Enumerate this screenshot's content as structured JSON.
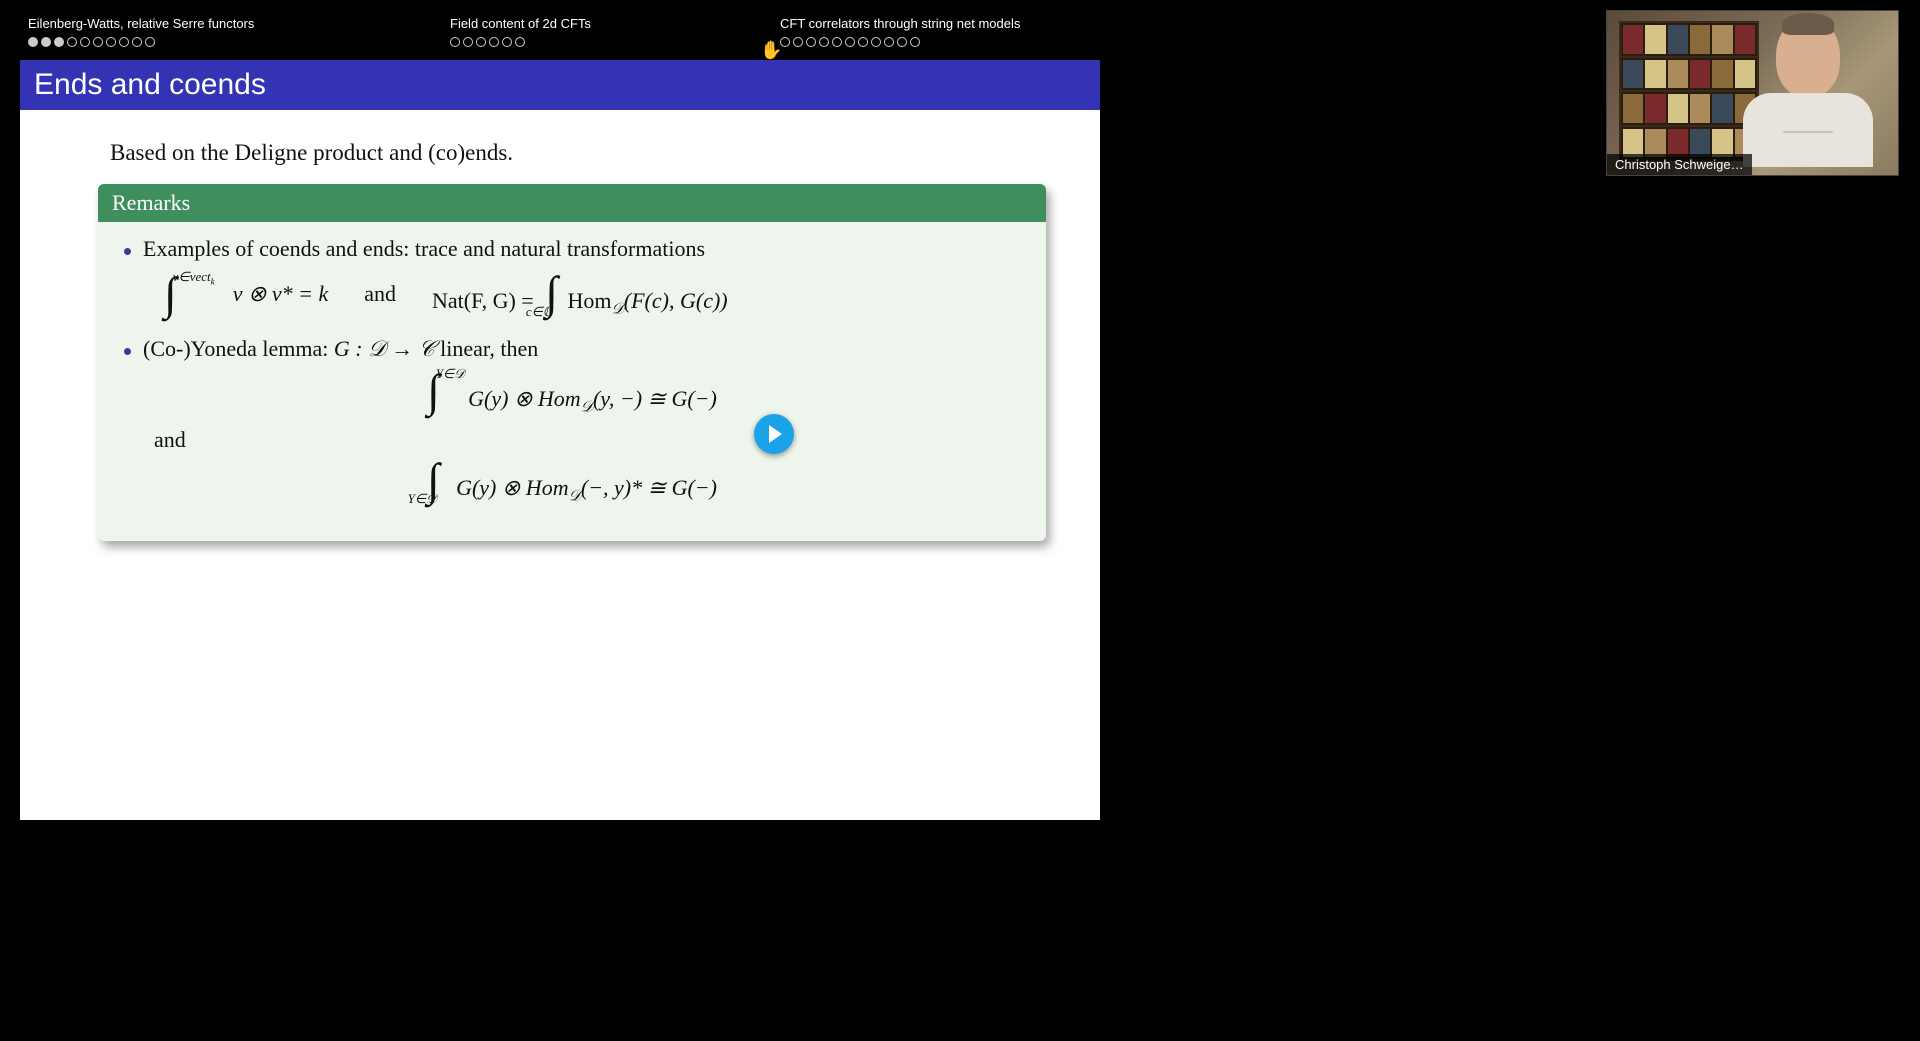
{
  "nav": {
    "sections": [
      {
        "title": "Eilenberg-Watts, relative Serre functors",
        "total": 10,
        "filled": 3,
        "current": 2
      },
      {
        "title": "Field content of 2d CFTs",
        "total": 6,
        "filled": 0,
        "current": -1
      },
      {
        "title": "CFT correlators through string net models",
        "total": 11,
        "filled": 0,
        "current": -1
      }
    ]
  },
  "slide": {
    "title": "Ends and coends",
    "intro": "Based on the Deligne product and (co)ends.",
    "remarks_head": "Remarks",
    "bullet1": "Examples of coends and ends: trace and natural transformations",
    "eq1_sup": "v∈vect",
    "eq1_sup_sub": "k",
    "eq1_body": "v ⊗ v* = k",
    "eq1_and": "and",
    "eq1_nat_lhs": "Nat(F, G) =",
    "eq1_int_sub": "c∈ℂ",
    "eq1_hom": "Hom",
    "eq1_hom_sub": "𝒟",
    "eq1_hom_args": "(F(c), G(c))",
    "bullet2_pre": "(Co-)Yoneda lemma: ",
    "bullet2_g": "G : 𝒟 → 𝒞",
    "bullet2_post": " linear, then",
    "eq2_sup": "Y∈𝒟",
    "eq2_body_a": "G(y) ⊗ Hom",
    "eq2_body_sub": "𝒟",
    "eq2_body_b": "(y, −) ≅ G(−)",
    "and_text": "and",
    "eq3_sub": "Y∈𝒟",
    "eq3_body_a": "G(y) ⊗ Hom",
    "eq3_body_sub": "𝒟",
    "eq3_body_b": "(−, y)* ≅ G(−)"
  },
  "webcam": {
    "name": "Christoph Schweige…"
  }
}
